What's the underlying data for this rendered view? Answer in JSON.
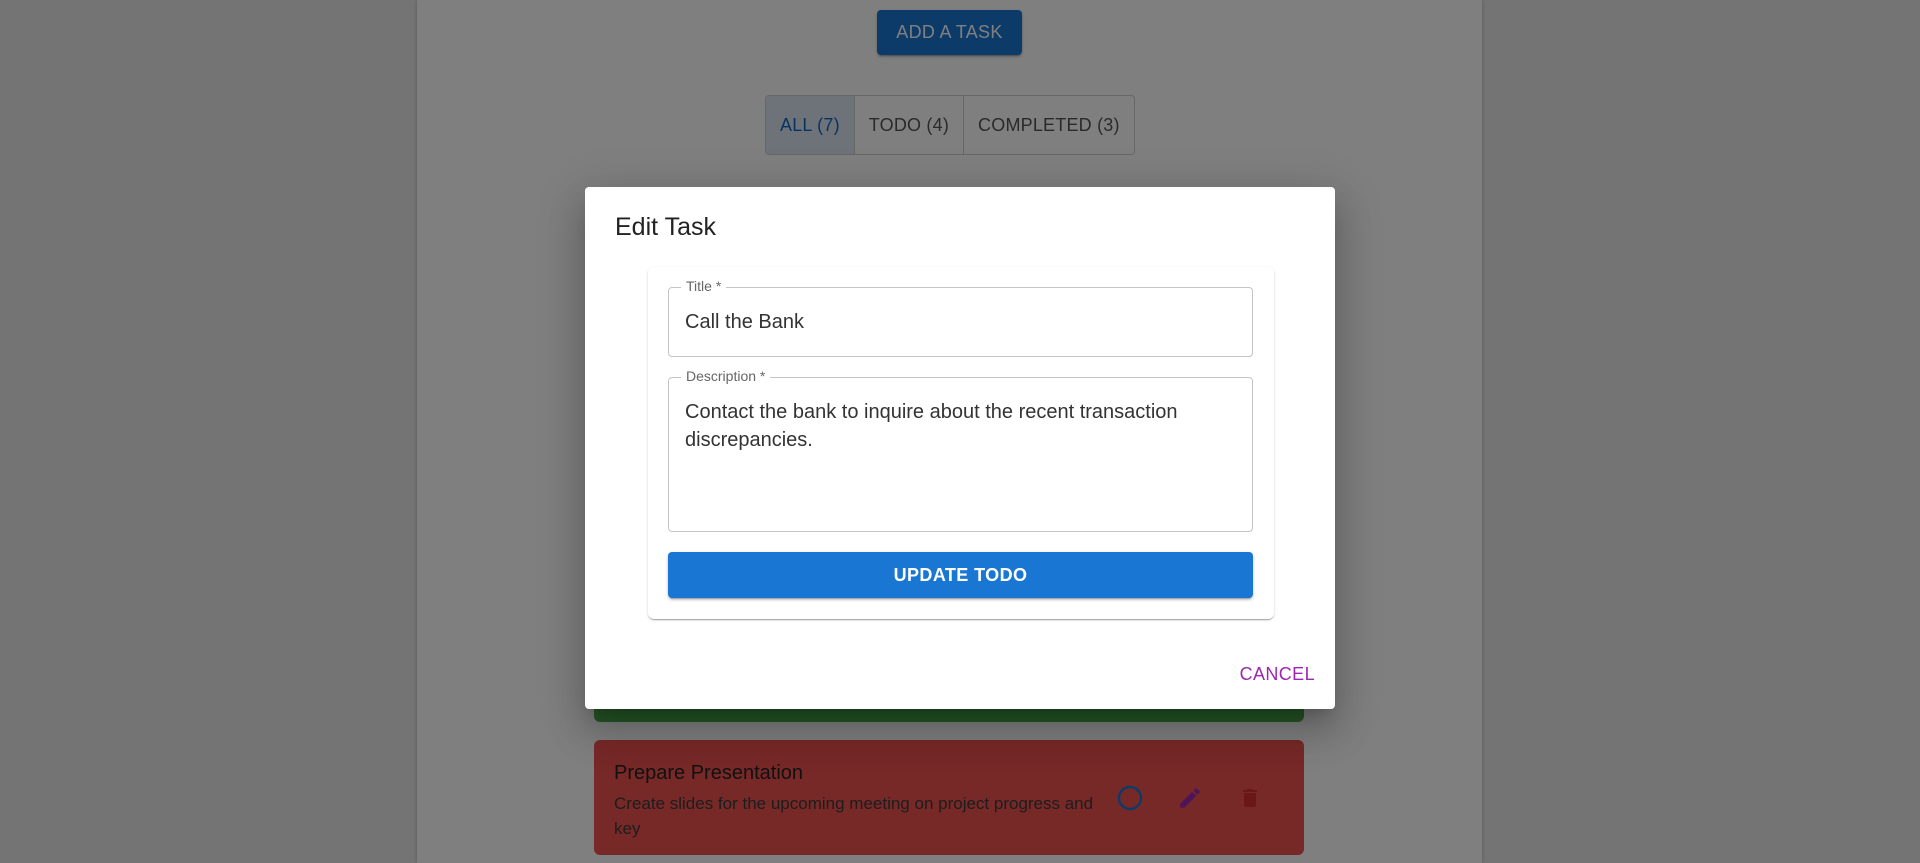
{
  "toolbar": {
    "add_task_label": "ADD A TASK"
  },
  "filters": [
    {
      "label": "ALL (7)",
      "active": true
    },
    {
      "label": "TODO (4)",
      "active": false
    },
    {
      "label": "COMPLETED (3)",
      "active": false
    }
  ],
  "tasks": [
    {
      "title": "Prepare Presentation",
      "description": "Create slides for the upcoming meeting on project progress and key",
      "status_color": "#ef5350",
      "icons": [
        "circle-outline-icon",
        "pencil-icon",
        "trash-icon"
      ]
    }
  ],
  "dialog": {
    "title": "Edit Task",
    "title_field": {
      "label": "Title *",
      "value": "Call the Bank"
    },
    "description_field": {
      "label": "Description *",
      "value": "Contact the bank to inquire about the recent transaction discrepancies."
    },
    "update_label": "UPDATE TODO",
    "cancel_label": "CANCEL"
  },
  "colors": {
    "primary": "#1976d2",
    "secondary": "#9c27b0",
    "completed_card": "#4caf50",
    "todo_card": "#ef5350"
  }
}
